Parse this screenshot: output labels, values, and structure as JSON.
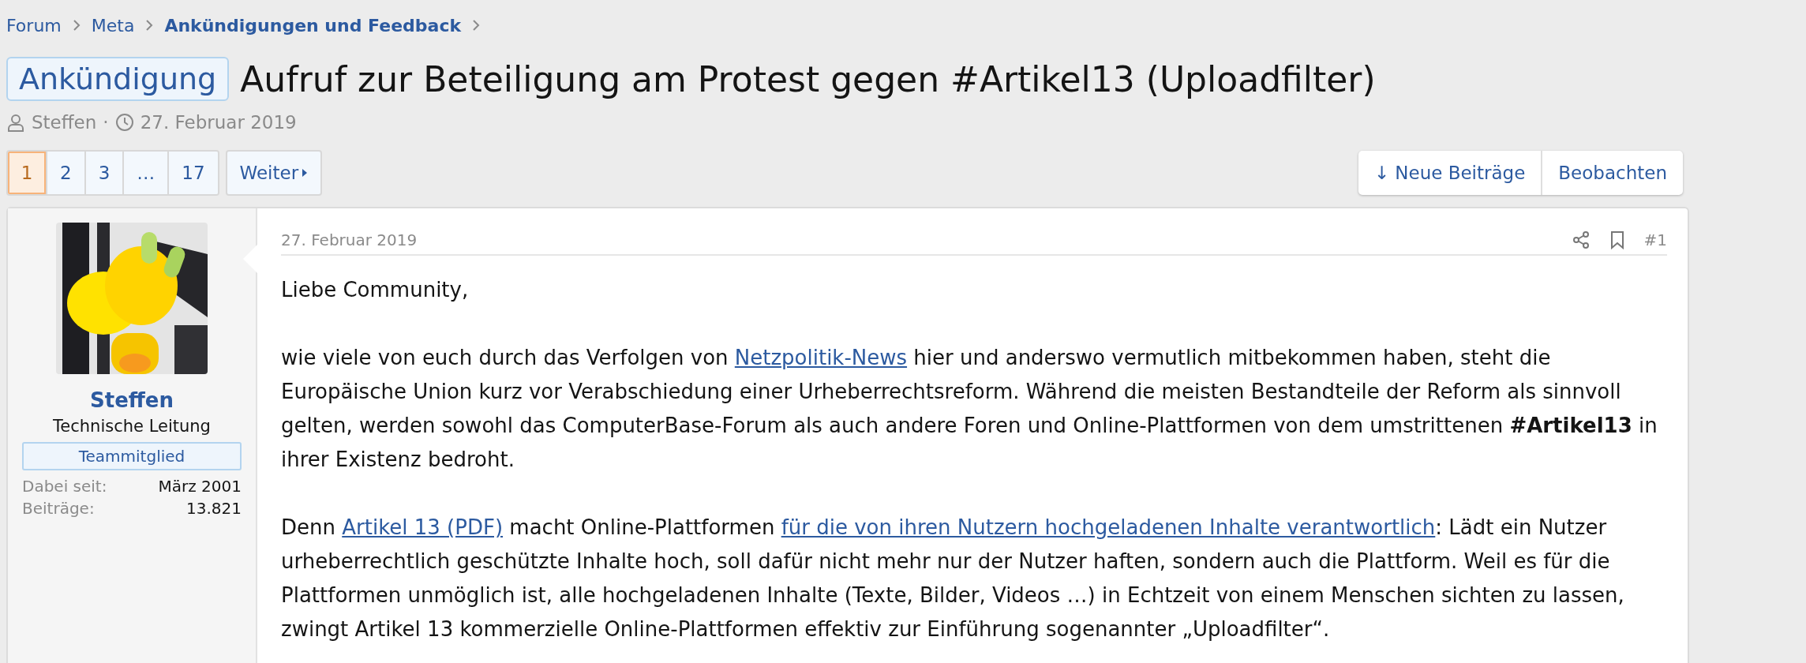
{
  "breadcrumb": [
    {
      "label": "Forum",
      "current": false
    },
    {
      "label": "Meta",
      "current": false
    },
    {
      "label": "Ankündigungen und Feedback",
      "current": true
    }
  ],
  "thread": {
    "prefix": "Ankündigung",
    "title": "Aufruf zur Beteiligung am Protest gegen #Artikel13 (Uploadfilter)",
    "author": "Steffen",
    "separator": "·",
    "date": "27. Februar 2019"
  },
  "pagination": {
    "pages": [
      {
        "label": "1",
        "selected": true
      },
      {
        "label": "2",
        "selected": false
      },
      {
        "label": "3",
        "selected": false
      },
      {
        "label": "…",
        "selected": false
      },
      {
        "label": "17",
        "selected": false
      }
    ],
    "next": "Weiter"
  },
  "actions": [
    "↓ Neue Beiträge",
    "Beobachten"
  ],
  "post": {
    "user": {
      "name": "Steffen",
      "title": "Technische Leitung",
      "banner": "Teammitglied",
      "stats": [
        {
          "label": "Dabei seit:",
          "value": "März 2001"
        },
        {
          "label": "Beiträge:",
          "value": "13.821"
        }
      ]
    },
    "date": "27. Februar 2019",
    "number": "#1",
    "paragraphs": [
      [
        {
          "text": "Liebe Community,"
        }
      ],
      [
        {
          "text": "wie viele von euch durch das Verfolgen von "
        },
        {
          "text": "Netzpolitik-News",
          "kind": "link"
        },
        {
          "text": " hier und anderswo vermutlich mitbekommen haben, steht die Europäische Union kurz vor Verabschiedung einer Urheberrechtsreform. Während die meisten Bestandteile der Reform als sinnvoll gelten, werden sowohl das ComputerBase-Forum als auch andere Foren und Online-Plattformen von dem umstrittenen "
        },
        {
          "text": "#Artikel13",
          "kind": "bold"
        },
        {
          "text": " in ihrer Existenz bedroht."
        }
      ],
      [
        {
          "text": "Denn "
        },
        {
          "text": "Artikel 13 (PDF)",
          "kind": "link"
        },
        {
          "text": " macht Online-Plattformen "
        },
        {
          "text": "für die von ihren Nutzern hochgeladenen Inhalte verantwortlich",
          "kind": "link"
        },
        {
          "text": ": Lädt ein Nutzer urheberrechtlich geschützte Inhalte hoch, soll dafür nicht mehr nur der Nutzer haften, sondern auch die Plattform. Weil es für die Plattformen unmöglich ist, alle hochgeladenen Inhalte (Texte, Bilder, Videos …) in Echtzeit von einem Menschen sichten zu lassen, zwingt Artikel 13 kommerzielle Online-Plattformen effektiv zur Einführung sogenannter „Uploadfilter“."
        }
      ]
    ]
  }
}
